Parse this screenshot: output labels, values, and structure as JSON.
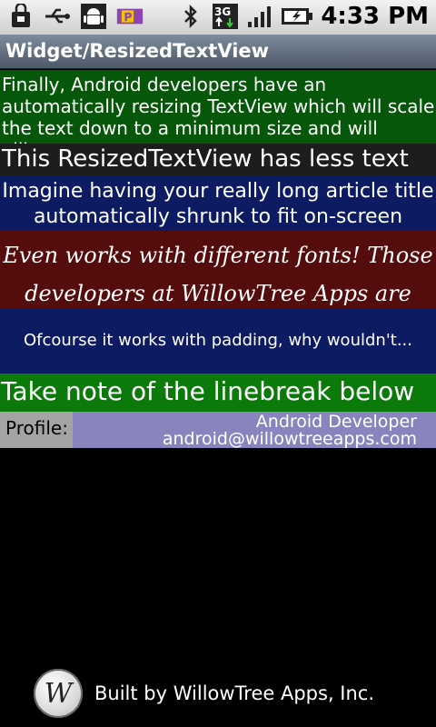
{
  "status_bar": {
    "time": "4:33 PM",
    "network_label": "3G",
    "icons": [
      "shopping-bag-icon",
      "usb-icon",
      "android-debug-icon",
      "p-notification-icon",
      "bluetooth-icon",
      "3g-icon",
      "signal-icon",
      "battery-charging-icon"
    ]
  },
  "app": {
    "title": "Widget/ResizedTextView"
  },
  "rows": {
    "r1": "Finally, Android developers have an automatically resizing TextView which will scale the text down to a minimum size and will ellip...",
    "r2": "This ResizedTextView has less text",
    "r3": "Imagine having your really long article title automatically shrunk to fit on-screen",
    "r4": "Even works with different fonts! Those developers at WillowTree Apps are genius!",
    "r5": "Ofcourse it works with padding, why wouldn't...",
    "r6": "Take note of the linebreak below"
  },
  "profile": {
    "label": "Profile:",
    "line1": "Android Developer",
    "line2": "android@willowtreeapps.com"
  },
  "footer": {
    "logo_letter": "W",
    "text": "Built by WillowTree Apps, Inc."
  },
  "colors": {
    "green_row": "#06570a",
    "navy_row": "#0d1b63",
    "maroon_row": "#540c0c",
    "bright_green_row": "#0b7a0b",
    "profile_value_bg": "#8884bd"
  }
}
